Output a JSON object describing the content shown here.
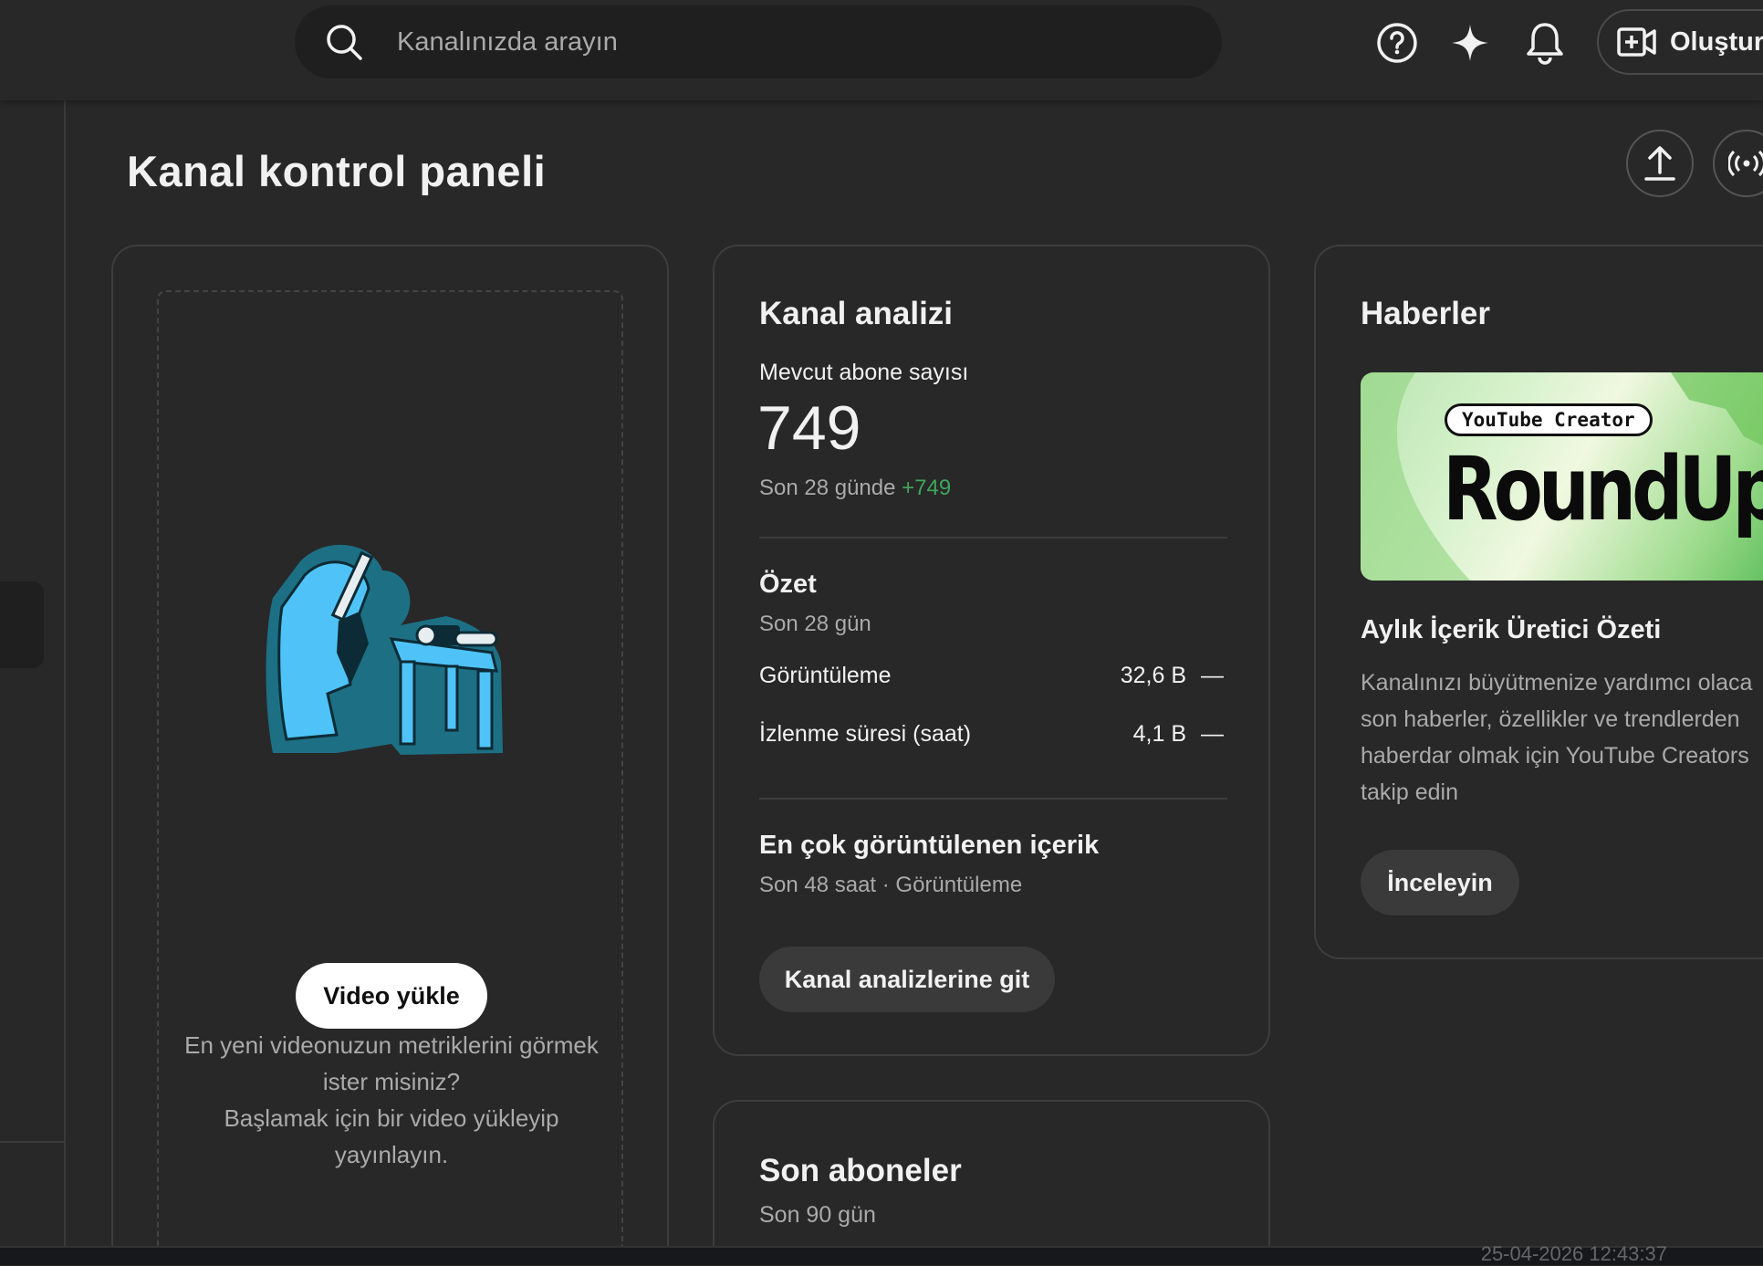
{
  "search": {
    "placeholder": "Kanalınızda arayın"
  },
  "topbar": {
    "help_icon": "help-circle-icon",
    "sparkle_icon": "sparkle-icon",
    "bell_icon": "bell-icon",
    "create_label": "Oluştur"
  },
  "page": {
    "title": "Kanal kontrol paneli"
  },
  "upload_card": {
    "text": [
      "En yeni videonuzun metriklerini görmek",
      "ister misiniz?",
      "Başlamak için bir video yükleyip",
      "yayınlayın."
    ],
    "button": "Video yükle"
  },
  "analytics": {
    "title": "Kanal analizi",
    "subs_label": "Mevcut abone sayısı",
    "subs_value": "749",
    "subs_period": "Son 28 günde",
    "subs_change": "+749",
    "summary_title": "Özet",
    "summary_period": "Son 28 gün",
    "rows": [
      {
        "label": "Görüntüleme",
        "value": "32,6 B",
        "trend": "—"
      },
      {
        "label": "İzlenme süresi (saat)",
        "value": "4,1 B",
        "trend": "—"
      }
    ],
    "top_title": "En çok görüntülenen içerik",
    "top_meta": "Son 48 saat · Görüntüleme",
    "button": "Kanal analizlerine git"
  },
  "recent_subs": {
    "title": "Son aboneler",
    "period": "Son 90 gün"
  },
  "news": {
    "title": "Haberler",
    "banner_small": "YouTube Creator",
    "banner_big": "RoundUp",
    "headline": "Aylık İçerik Üretici Özeti",
    "body": [
      "Kanalınızı büyütmenize yardımcı olaca",
      "son haberler, özellikler ve trendlerden",
      "haberdar olmak için YouTube Creators",
      "takip edin"
    ],
    "button": "İnceleyin"
  },
  "status": {
    "timestamp": "25-04-2026 12:43:37"
  }
}
